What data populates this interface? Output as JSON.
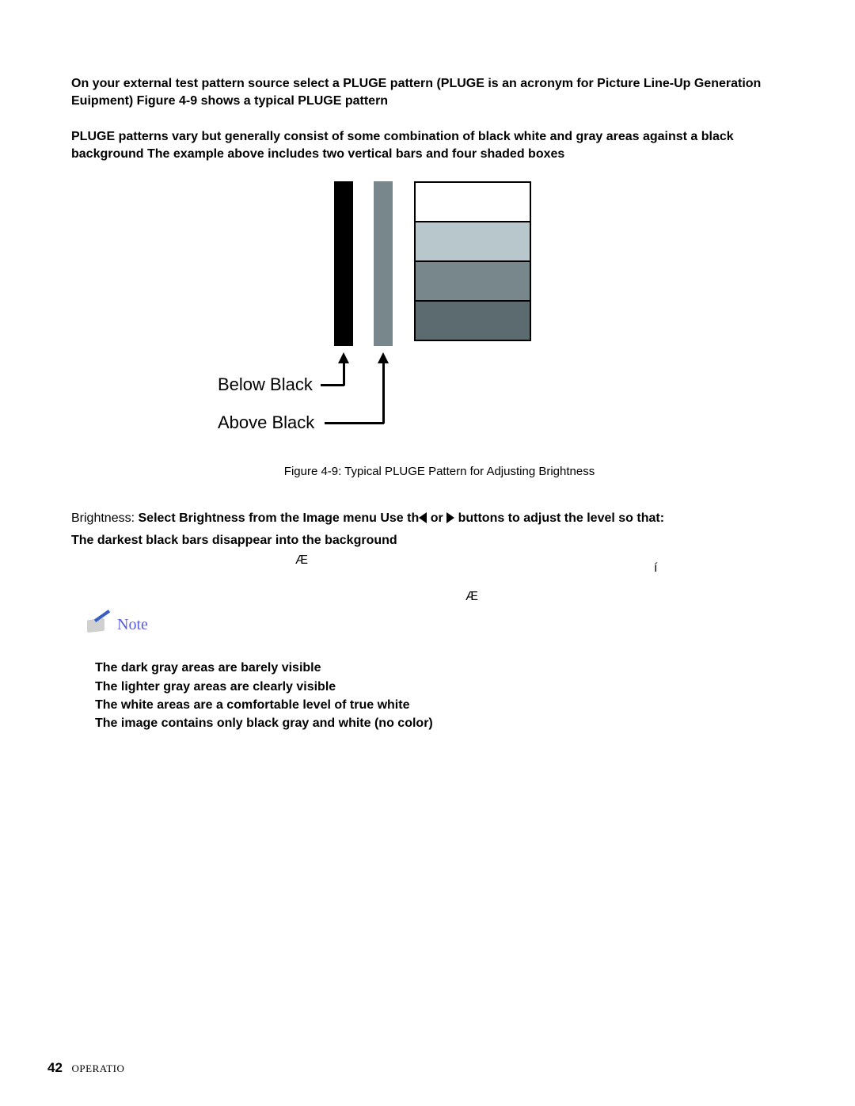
{
  "para1": "On your external test pattern source select a PLUGE pattern (PLUGE is an acronym for Picture Line-Up Generation Euipment) Figure 4-9 shows a typical PLUGE pattern",
  "para2": "PLUGE patterns vary but generally consist of some combination of black white and gray areas against a black background The example above includes two vertical bars and four shaded boxes",
  "figure": {
    "label_below": "Below Black",
    "label_above": "Above Black",
    "caption": "Figure 4-9: Typical PLUGE Pattern for Adjusting Brightness"
  },
  "brightness": {
    "lead": "Brightness:",
    "part1": "Select Brightness from the Image menu Use th",
    "or": " or ",
    "part2": " buttons to adjust the level so that:",
    "line2": "The darkest black bars disappear into the background"
  },
  "note_label": "Note",
  "stray1": "Æ",
  "stray2": "í",
  "stray3": "Æ",
  "bullets": [
    "The dark gray areas are barely visible",
    "The lighter gray areas are clearly visible",
    "The white areas are a comfortable level of true white",
    "The image contains only black gray and white (no color)"
  ],
  "footer": {
    "page": "42",
    "section": "OPERATIO"
  }
}
